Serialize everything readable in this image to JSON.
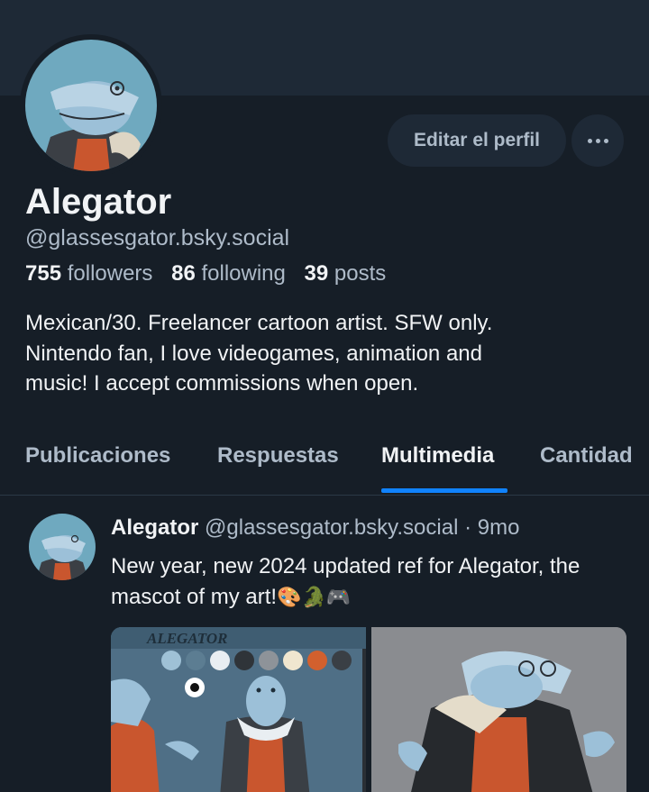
{
  "profile": {
    "name": "Alegator",
    "handle": "@glassesgator.bsky.social",
    "stats": {
      "followers_count": "755",
      "followers_label": "followers",
      "following_count": "86",
      "following_label": "following",
      "posts_count": "39",
      "posts_label": "posts"
    },
    "bio": "Mexican/30. Freelancer cartoon artist. SFW only.\nNintendo fan, I love videogames, animation and\nmusic! I accept commissions when open."
  },
  "actions": {
    "edit_label": "Editar el perfil",
    "more_icon": "ellipsis-icon"
  },
  "tabs": [
    {
      "label": "Publicaciones",
      "active": false
    },
    {
      "label": "Respuestas",
      "active": false
    },
    {
      "label": "Multimedia",
      "active": true
    },
    {
      "label": "Cantidad",
      "active": false
    }
  ],
  "post": {
    "author": "Alegator",
    "handle": "@glassesgator.bsky.social",
    "separator": "·",
    "time": "9mo",
    "text": "New year, new 2024 updated ref for Alegator, the mascot of my art!",
    "emojis": "🎨🐊🎮",
    "image_banner_text": "ALEGATOR"
  },
  "colors": {
    "background": "#161e27",
    "banner": "#1e2936",
    "accent": "#1083fe",
    "muted_text": "#aebbc9"
  }
}
